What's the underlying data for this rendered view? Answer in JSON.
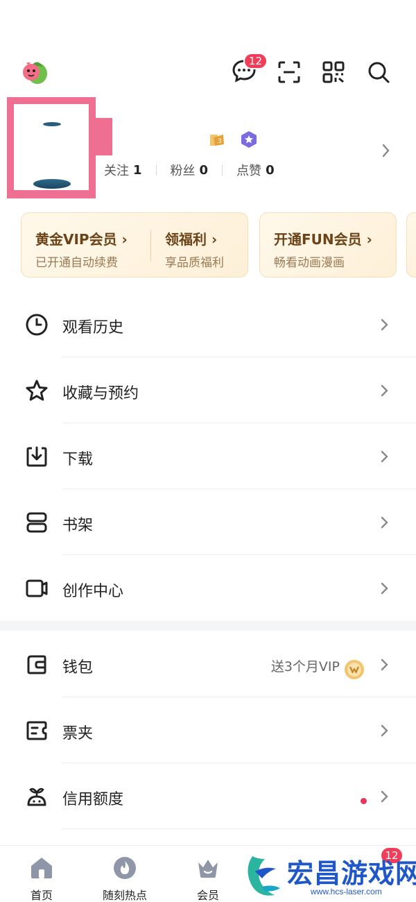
{
  "header": {
    "message_badge": "12",
    "icons": [
      "mascot-icon",
      "message-icon",
      "scan-icon",
      "qr-code-icon",
      "search-icon"
    ]
  },
  "profile": {
    "stats": [
      {
        "label": "关注",
        "value": "1"
      },
      {
        "label": "粉丝",
        "value": "0"
      },
      {
        "label": "点赞",
        "value": "0"
      }
    ]
  },
  "member_cards": {
    "gold_vip_title": "黄金VIP会员",
    "gold_vip_sub": "已开通自动续费",
    "benefit_title": "领福利",
    "benefit_sub": "享品质福利",
    "fun_title": "开通FUN会员",
    "fun_sub": "畅看动画漫画",
    "chevron": "›"
  },
  "menu_section1": [
    {
      "label": "观看历史",
      "icon": "clock-icon"
    },
    {
      "label": "收藏与预约",
      "icon": "star-icon"
    },
    {
      "label": "下载",
      "icon": "download-icon"
    },
    {
      "label": "书架",
      "icon": "bookshelf-icon"
    },
    {
      "label": "创作中心",
      "icon": "camera-icon"
    }
  ],
  "menu_section2": [
    {
      "label": "钱包",
      "icon": "wallet-icon",
      "extra": "送3个月VIP"
    },
    {
      "label": "票夹",
      "icon": "ticket-icon"
    },
    {
      "label": "信用额度",
      "icon": "credit-icon"
    }
  ],
  "bottom_nav": {
    "items": [
      {
        "label": "首页",
        "icon": "home-icon"
      },
      {
        "label": "随刻热点",
        "icon": "flame-icon"
      },
      {
        "label": "会员",
        "icon": "crown-icon"
      }
    ],
    "badge": "12"
  },
  "watermark": {
    "text": "宏昌游戏网",
    "url": "www.hcs-laser.com"
  },
  "colors": {
    "accent_red": "#ef3d5a",
    "gold_text": "#6b4317",
    "watermark_blue": "#1f57c9"
  }
}
